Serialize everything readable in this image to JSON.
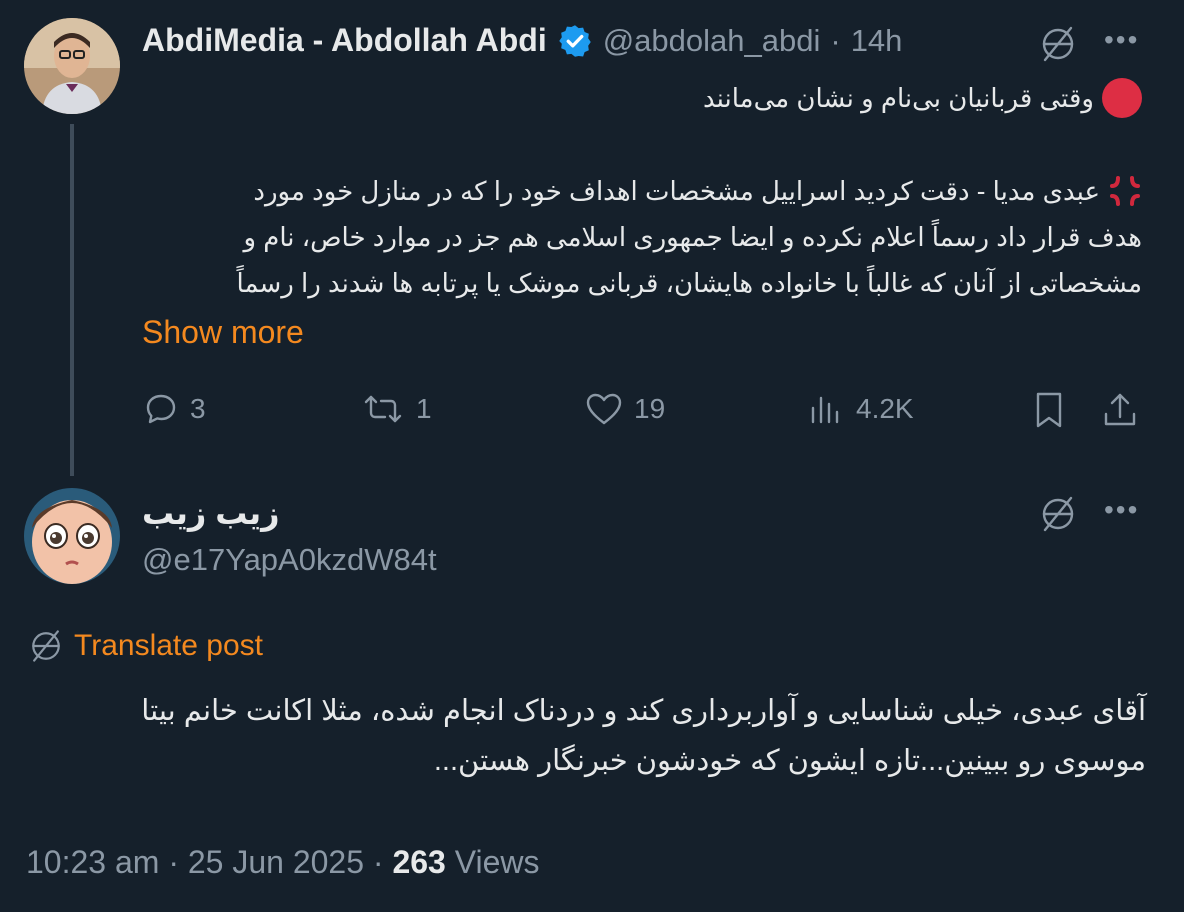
{
  "tweet": {
    "author_name": "AbdiMedia - Abdollah Abdi",
    "handle": "@abdolah_abdi",
    "separator": "·",
    "time": "14h",
    "title_line": "وقتی قربانیان بی‌نام و نشان می‌مانند",
    "body_lines": [
      "عبدی مدیا - دقت کردید اسراییل مشخصات اهداف خود را که در منازل خود مورد",
      "هدف قرار داد رسماً اعلام نکرده و ایضا جمهوری اسلامی هم جز در موارد خاص، نام و",
      "مشخصاتی از آنان که غالباً با خانواده هایشان، قربانی موشک یا پرتابه ها شدند را رسماً"
    ],
    "show_more": "Show more",
    "stats": {
      "replies": "3",
      "reposts": "1",
      "likes": "19",
      "views": "4.2K"
    }
  },
  "reply": {
    "author_name": "زیب زیب",
    "handle": "@e17YapA0kzdW84t",
    "translate_label": "Translate post",
    "body_lines": [
      "آقای عبدی، خیلی شناسایی و آواربرداری کند و دردناک انجام شده، مثلا اکانت خانم بیتا",
      "موسوی رو ببینین...تازه ایشون که خودشون خبرنگار هستن..."
    ],
    "footer": {
      "time": "10:23 am",
      "sep1": "·",
      "date": "25 Jun 2025",
      "sep2": "·",
      "views_count": "263",
      "views_label": "Views"
    }
  },
  "colors": {
    "background": "#15202b",
    "accent_orange": "#f4891f",
    "verified_blue": "#1d9bf0",
    "muted_text": "#8b98a5",
    "red_circle": "#dd2e44"
  },
  "icons": [
    "verified-badge-icon",
    "translate-globe-icon",
    "more-icon",
    "reply-icon",
    "repost-icon",
    "like-icon",
    "views-icon",
    "bookmark-icon",
    "share-icon",
    "red-circle-icon",
    "anger-symbol-icon"
  ]
}
